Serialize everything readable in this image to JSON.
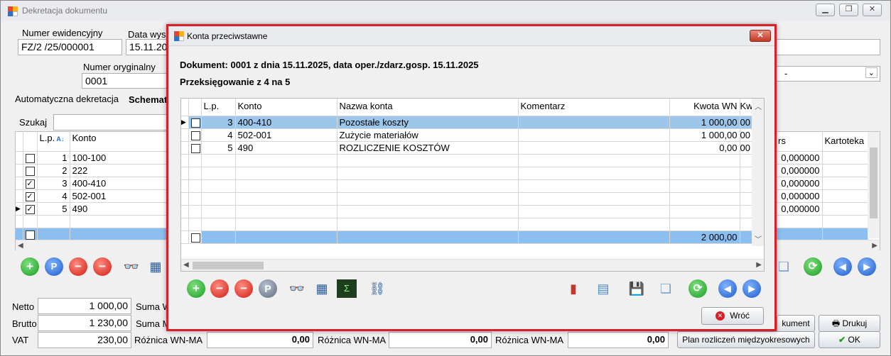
{
  "main": {
    "title": "Dekretacja dokumentu",
    "numer_ewid_label": "Numer ewidencyjny",
    "numer_ewid_value": "FZ/2  /25/000001",
    "data_wys_label": "Data wys",
    "data_wys_value": "15.11.20",
    "numer_oryg_label": "Numer oryginalny",
    "numer_oryg_value": "0001",
    "auto_dekretacja_label": "Automatyczna dekretacja",
    "schemat_label": "Schemat",
    "dropdown_value": "-",
    "szukaj_label": "Szukaj",
    "grid_headers": {
      "lp": "L.p.",
      "konto": "Konto",
      "rs": "rs",
      "kartoteka": "Kartoteka"
    },
    "rows": [
      {
        "num": "1",
        "konto": "100-100",
        "checked": "",
        "rate": "0,000000"
      },
      {
        "num": "2",
        "konto": "222",
        "checked": "",
        "rate": "0,000000"
      },
      {
        "num": "3",
        "konto": "400-410",
        "checked": "✓",
        "rate": "0,000000"
      },
      {
        "num": "4",
        "konto": "502-001",
        "checked": "✓",
        "rate": "0,000000"
      },
      {
        "num": "5",
        "konto": "490",
        "checked": "✓",
        "rate": "0,000000"
      }
    ],
    "netto_label": "Netto",
    "netto_value": "1 000,00",
    "brutto_label": "Brutto",
    "brutto_value": "1 230,00",
    "vat_label": "VAT",
    "vat_value": "230,00",
    "suma_w_label": "Suma W",
    "suma_m_label": "Suma M",
    "roznica_label": "Różnica WN-MA",
    "roznica1": "0,00",
    "roznica2": "0,00",
    "roznica3": "0,00",
    "dokument_btn": "kument",
    "drukuj_btn": "Drukuj",
    "plan_btn": "Plan rozliczeń międzyokresowych",
    "ok_btn": "OK"
  },
  "dialog": {
    "title": "Konta przeciwstawne",
    "close_glyph": "✕",
    "doc_line": "Dokument: 0001 z dnia 15.11.2025, data oper./zdarz.gosp. 15.11.2025",
    "przeksieg_line": "Przeksięgowanie z 4 na 5",
    "headers": {
      "lp": "L.p.",
      "konto": "Konto",
      "nazwa": "Nazwa konta",
      "komentarz": "Komentarz",
      "kwota_wn": "Kwota WN",
      "kwota_ma": "Kw"
    },
    "rows": [
      {
        "num": "3",
        "konto": "400-410",
        "nazwa": "Pozostałe koszty",
        "komentarz": "",
        "kwota_wn": "1 000,00",
        "kwota_ma": "00"
      },
      {
        "num": "4",
        "konto": "502-001",
        "nazwa": "Zużycie materiałów",
        "komentarz": "",
        "kwota_wn": "1 000,00",
        "kwota_ma": "00"
      },
      {
        "num": "5",
        "konto": "490",
        "nazwa": "ROZLICZENIE KOSZTÓW",
        "komentarz": "",
        "kwota_wn": "0,00",
        "kwota_ma": "00"
      }
    ],
    "sum_wn": "2 000,00",
    "wroc_btn": "Wróć"
  },
  "colors": {
    "dialog_border": "#d8202a",
    "selected_row": "#9cc7ea",
    "sum_row": "#8cbef0"
  }
}
